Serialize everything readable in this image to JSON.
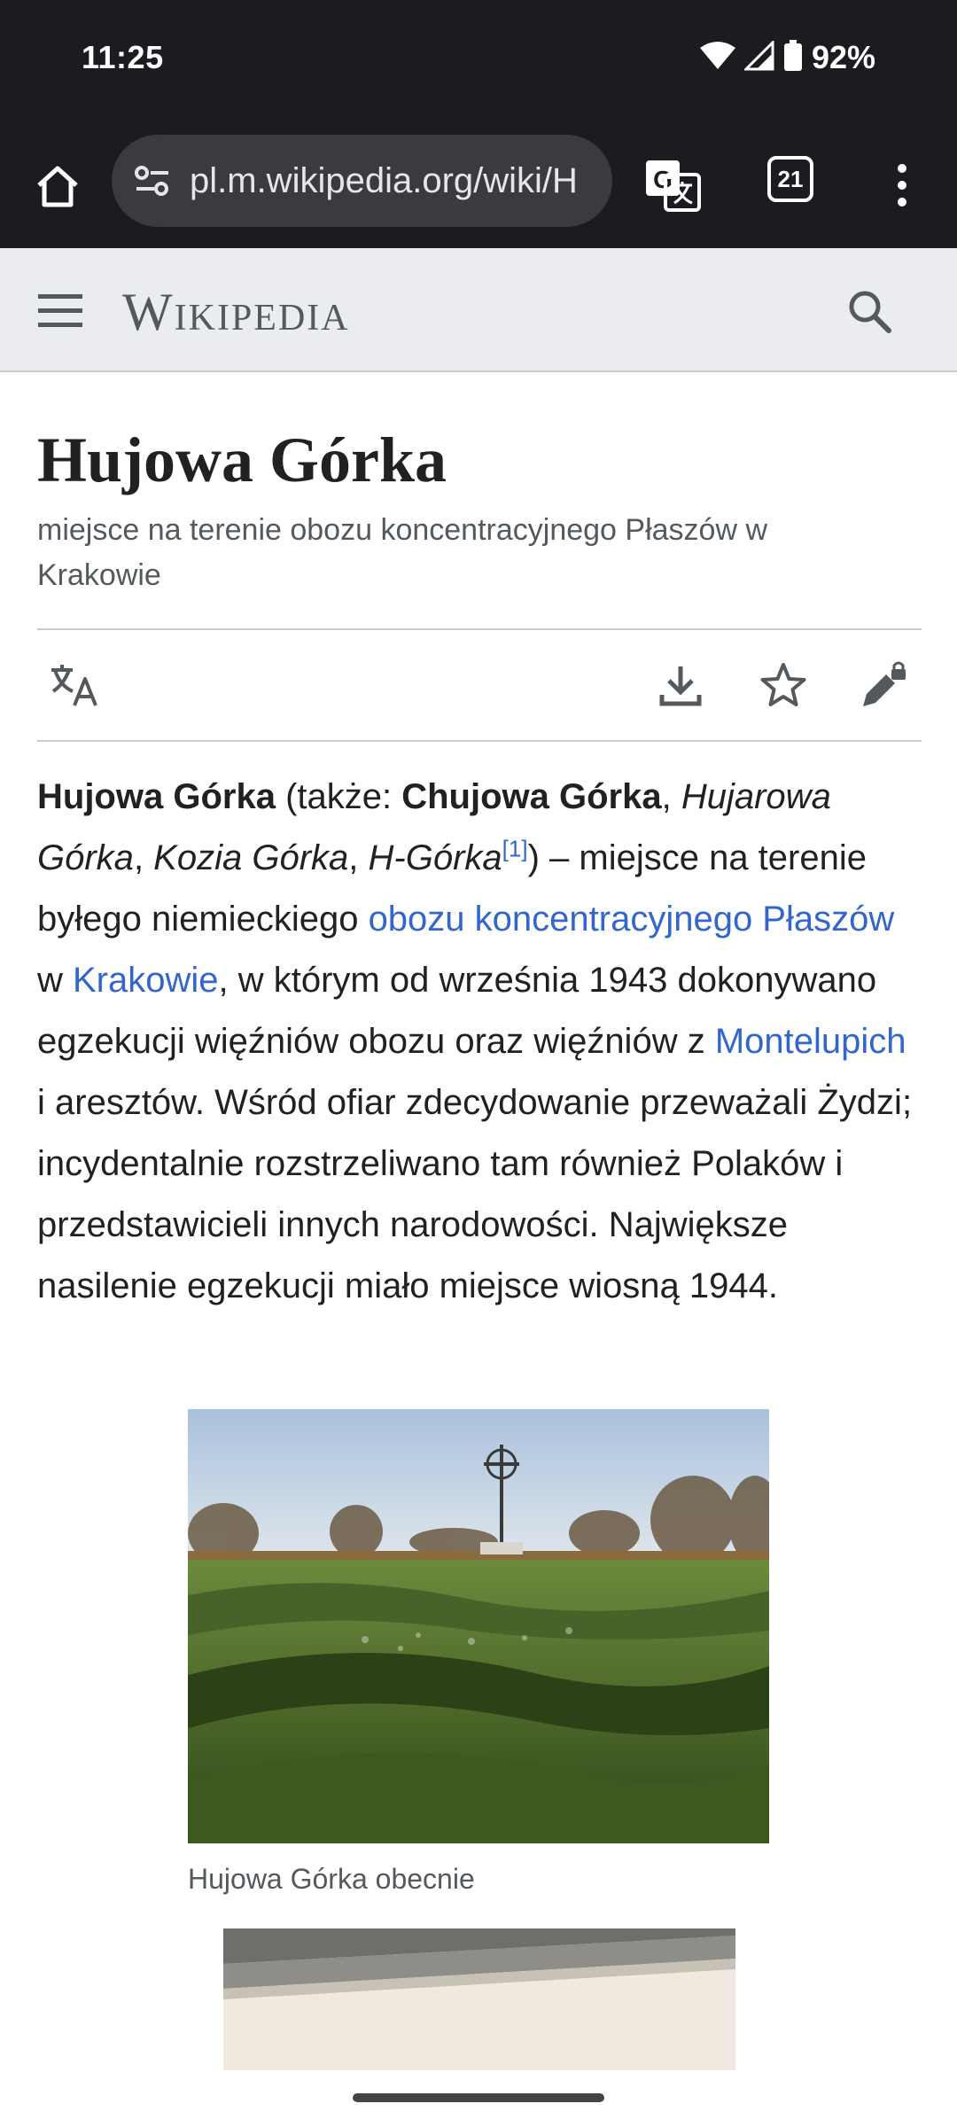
{
  "status_bar": {
    "time": "11:25",
    "battery": "92%"
  },
  "browser": {
    "url": "pl.m.wikipedia.org/wiki/H",
    "tab_count": "21"
  },
  "wiki_header": {
    "logo": "Wikipedia"
  },
  "article": {
    "title": "Hujowa Górka",
    "subtitle": "miejsce na terenie obozu koncentracyjnego Płaszów w Krakowie",
    "lead": {
      "b1": "Hujowa Górka",
      "t1": " (także: ",
      "b2": "Chujowa Górka",
      "t2": ", ",
      "i1": "Hujarowa Górka",
      "t3": ", ",
      "i2": "Kozia Górka",
      "t4": ", ",
      "i3": "H-Górka",
      "ref": "[1]",
      "t5": ") – miejsce na terenie byłego niemieckiego ",
      "link1": "obozu koncentracyjnego Płaszów",
      "t6": " w ",
      "link2": "Krakowie",
      "t7": ", w którym od września 1943 dokonywano egzekucji więźniów obozu oraz więźniów z ",
      "link3": "Montelupich",
      "t8": " i aresztów. Wśród ofiar zdecydowanie przeważali Żydzi; incydentalnie rozstrzeliwano tam również Polaków i przedstawicieli innych narodowości. Największe nasilenie egzekucji miało miejsce wiosną 1944."
    },
    "figure_caption": "Hujowa Górka obecnie"
  },
  "colors": {
    "link": "#3366cc",
    "header_bg": "#eaecf0",
    "browser_bg": "#1b1c1f"
  }
}
